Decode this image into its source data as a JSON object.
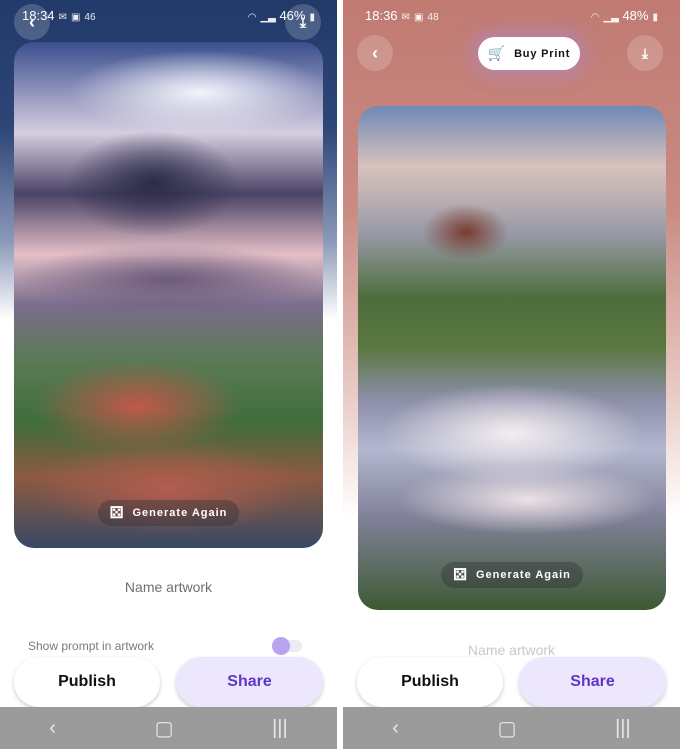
{
  "screens": [
    {
      "status": {
        "time": "18:34",
        "icons": [
          "gmail-icon",
          "gallery-icon",
          "badge-46"
        ],
        "badge": "46",
        "battery": "46%"
      },
      "generate_label": "Generate Again",
      "name_label": "Name artwork",
      "prompt_label": "Show prompt in artwork",
      "prompt_toggle_on": false,
      "publish_label": "Publish",
      "share_label": "Share"
    },
    {
      "status": {
        "time": "18:36",
        "icons": [
          "gmail-icon",
          "gallery-icon",
          "badge-48"
        ],
        "badge": "48",
        "battery": "48%"
      },
      "buy_print_label": "Buy Print",
      "generate_label": "Generate Again",
      "name_label": "Name artwork",
      "publish_label": "Publish",
      "share_label": "Share"
    }
  ],
  "colors": {
    "accent": "#5f36c8",
    "share_bg": "#ece7fd",
    "toggle_knob": "#b8a3f0",
    "nav_bar": "#9b9b9b"
  }
}
